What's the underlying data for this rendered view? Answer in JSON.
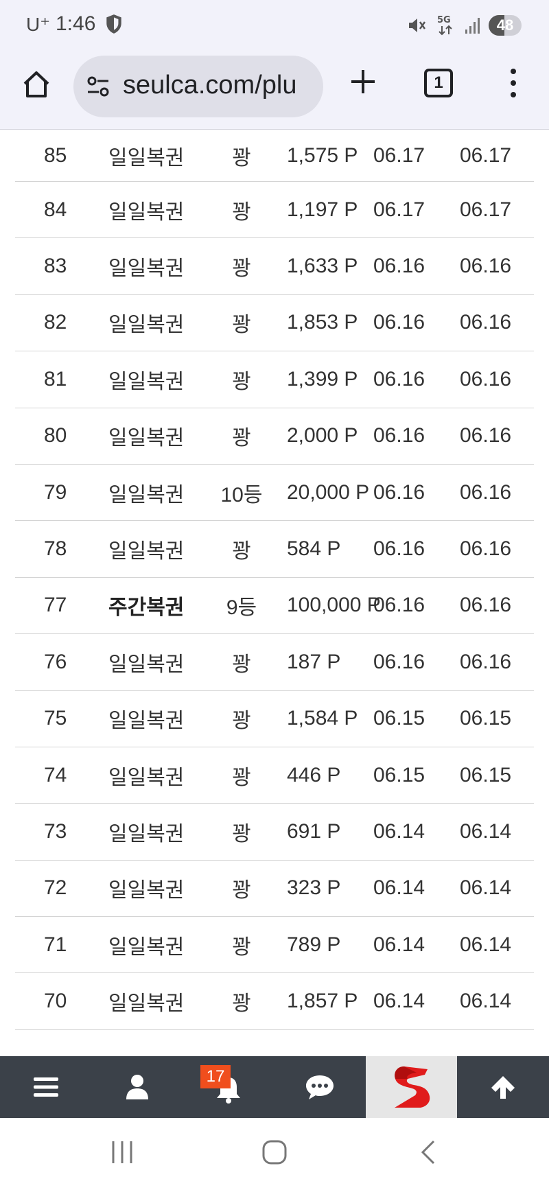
{
  "status_bar": {
    "carrier": "U⁺",
    "time": "1:46",
    "network": "5G",
    "battery": "48",
    "battery_level": 0.48
  },
  "browser": {
    "url": "seulca.com/plu",
    "tab_count": "1"
  },
  "table": {
    "rows": [
      {
        "no": "85",
        "type": "일일복권",
        "rank": "꽝",
        "point": "1,575 P",
        "date1": "06.17",
        "date2": "06.17",
        "bold": false
      },
      {
        "no": "84",
        "type": "일일복권",
        "rank": "꽝",
        "point": "1,197 P",
        "date1": "06.17",
        "date2": "06.17",
        "bold": false
      },
      {
        "no": "83",
        "type": "일일복권",
        "rank": "꽝",
        "point": "1,633 P",
        "date1": "06.16",
        "date2": "06.16",
        "bold": false
      },
      {
        "no": "82",
        "type": "일일복권",
        "rank": "꽝",
        "point": "1,853 P",
        "date1": "06.16",
        "date2": "06.16",
        "bold": false
      },
      {
        "no": "81",
        "type": "일일복권",
        "rank": "꽝",
        "point": "1,399 P",
        "date1": "06.16",
        "date2": "06.16",
        "bold": false
      },
      {
        "no": "80",
        "type": "일일복권",
        "rank": "꽝",
        "point": "2,000 P",
        "date1": "06.16",
        "date2": "06.16",
        "bold": false
      },
      {
        "no": "79",
        "type": "일일복권",
        "rank": "10등",
        "point": "20,000 P",
        "date1": "06.16",
        "date2": "06.16",
        "bold": false
      },
      {
        "no": "78",
        "type": "일일복권",
        "rank": "꽝",
        "point": "584 P",
        "date1": "06.16",
        "date2": "06.16",
        "bold": false
      },
      {
        "no": "77",
        "type": "주간복권",
        "rank": "9등",
        "point": "100,000 P",
        "date1": "06.16",
        "date2": "06.16",
        "bold": true
      },
      {
        "no": "76",
        "type": "일일복권",
        "rank": "꽝",
        "point": "187 P",
        "date1": "06.16",
        "date2": "06.16",
        "bold": false
      },
      {
        "no": "75",
        "type": "일일복권",
        "rank": "꽝",
        "point": "1,584 P",
        "date1": "06.15",
        "date2": "06.15",
        "bold": false
      },
      {
        "no": "74",
        "type": "일일복권",
        "rank": "꽝",
        "point": "446 P",
        "date1": "06.15",
        "date2": "06.15",
        "bold": false
      },
      {
        "no": "73",
        "type": "일일복권",
        "rank": "꽝",
        "point": "691 P",
        "date1": "06.14",
        "date2": "06.14",
        "bold": false
      },
      {
        "no": "72",
        "type": "일일복권",
        "rank": "꽝",
        "point": "323 P",
        "date1": "06.14",
        "date2": "06.14",
        "bold": false
      },
      {
        "no": "71",
        "type": "일일복권",
        "rank": "꽝",
        "point": "789 P",
        "date1": "06.14",
        "date2": "06.14",
        "bold": false
      },
      {
        "no": "70",
        "type": "일일복권",
        "rank": "꽝",
        "point": "1,857 P",
        "date1": "06.14",
        "date2": "06.14",
        "bold": false
      }
    ]
  },
  "app_nav": {
    "items": [
      {
        "icon": "menu-icon"
      },
      {
        "icon": "user-icon"
      },
      {
        "icon": "bell-icon"
      },
      {
        "icon": "chat-icon"
      },
      {
        "icon": "site-logo-icon"
      },
      {
        "icon": "arrow-up-icon"
      }
    ],
    "notification_count": "17",
    "badge_color": "#f04e1d",
    "bar_color": "#3b4149"
  },
  "system_nav": {
    "icons": [
      "recent-apps-icon",
      "home-circle-icon",
      "back-icon"
    ]
  }
}
